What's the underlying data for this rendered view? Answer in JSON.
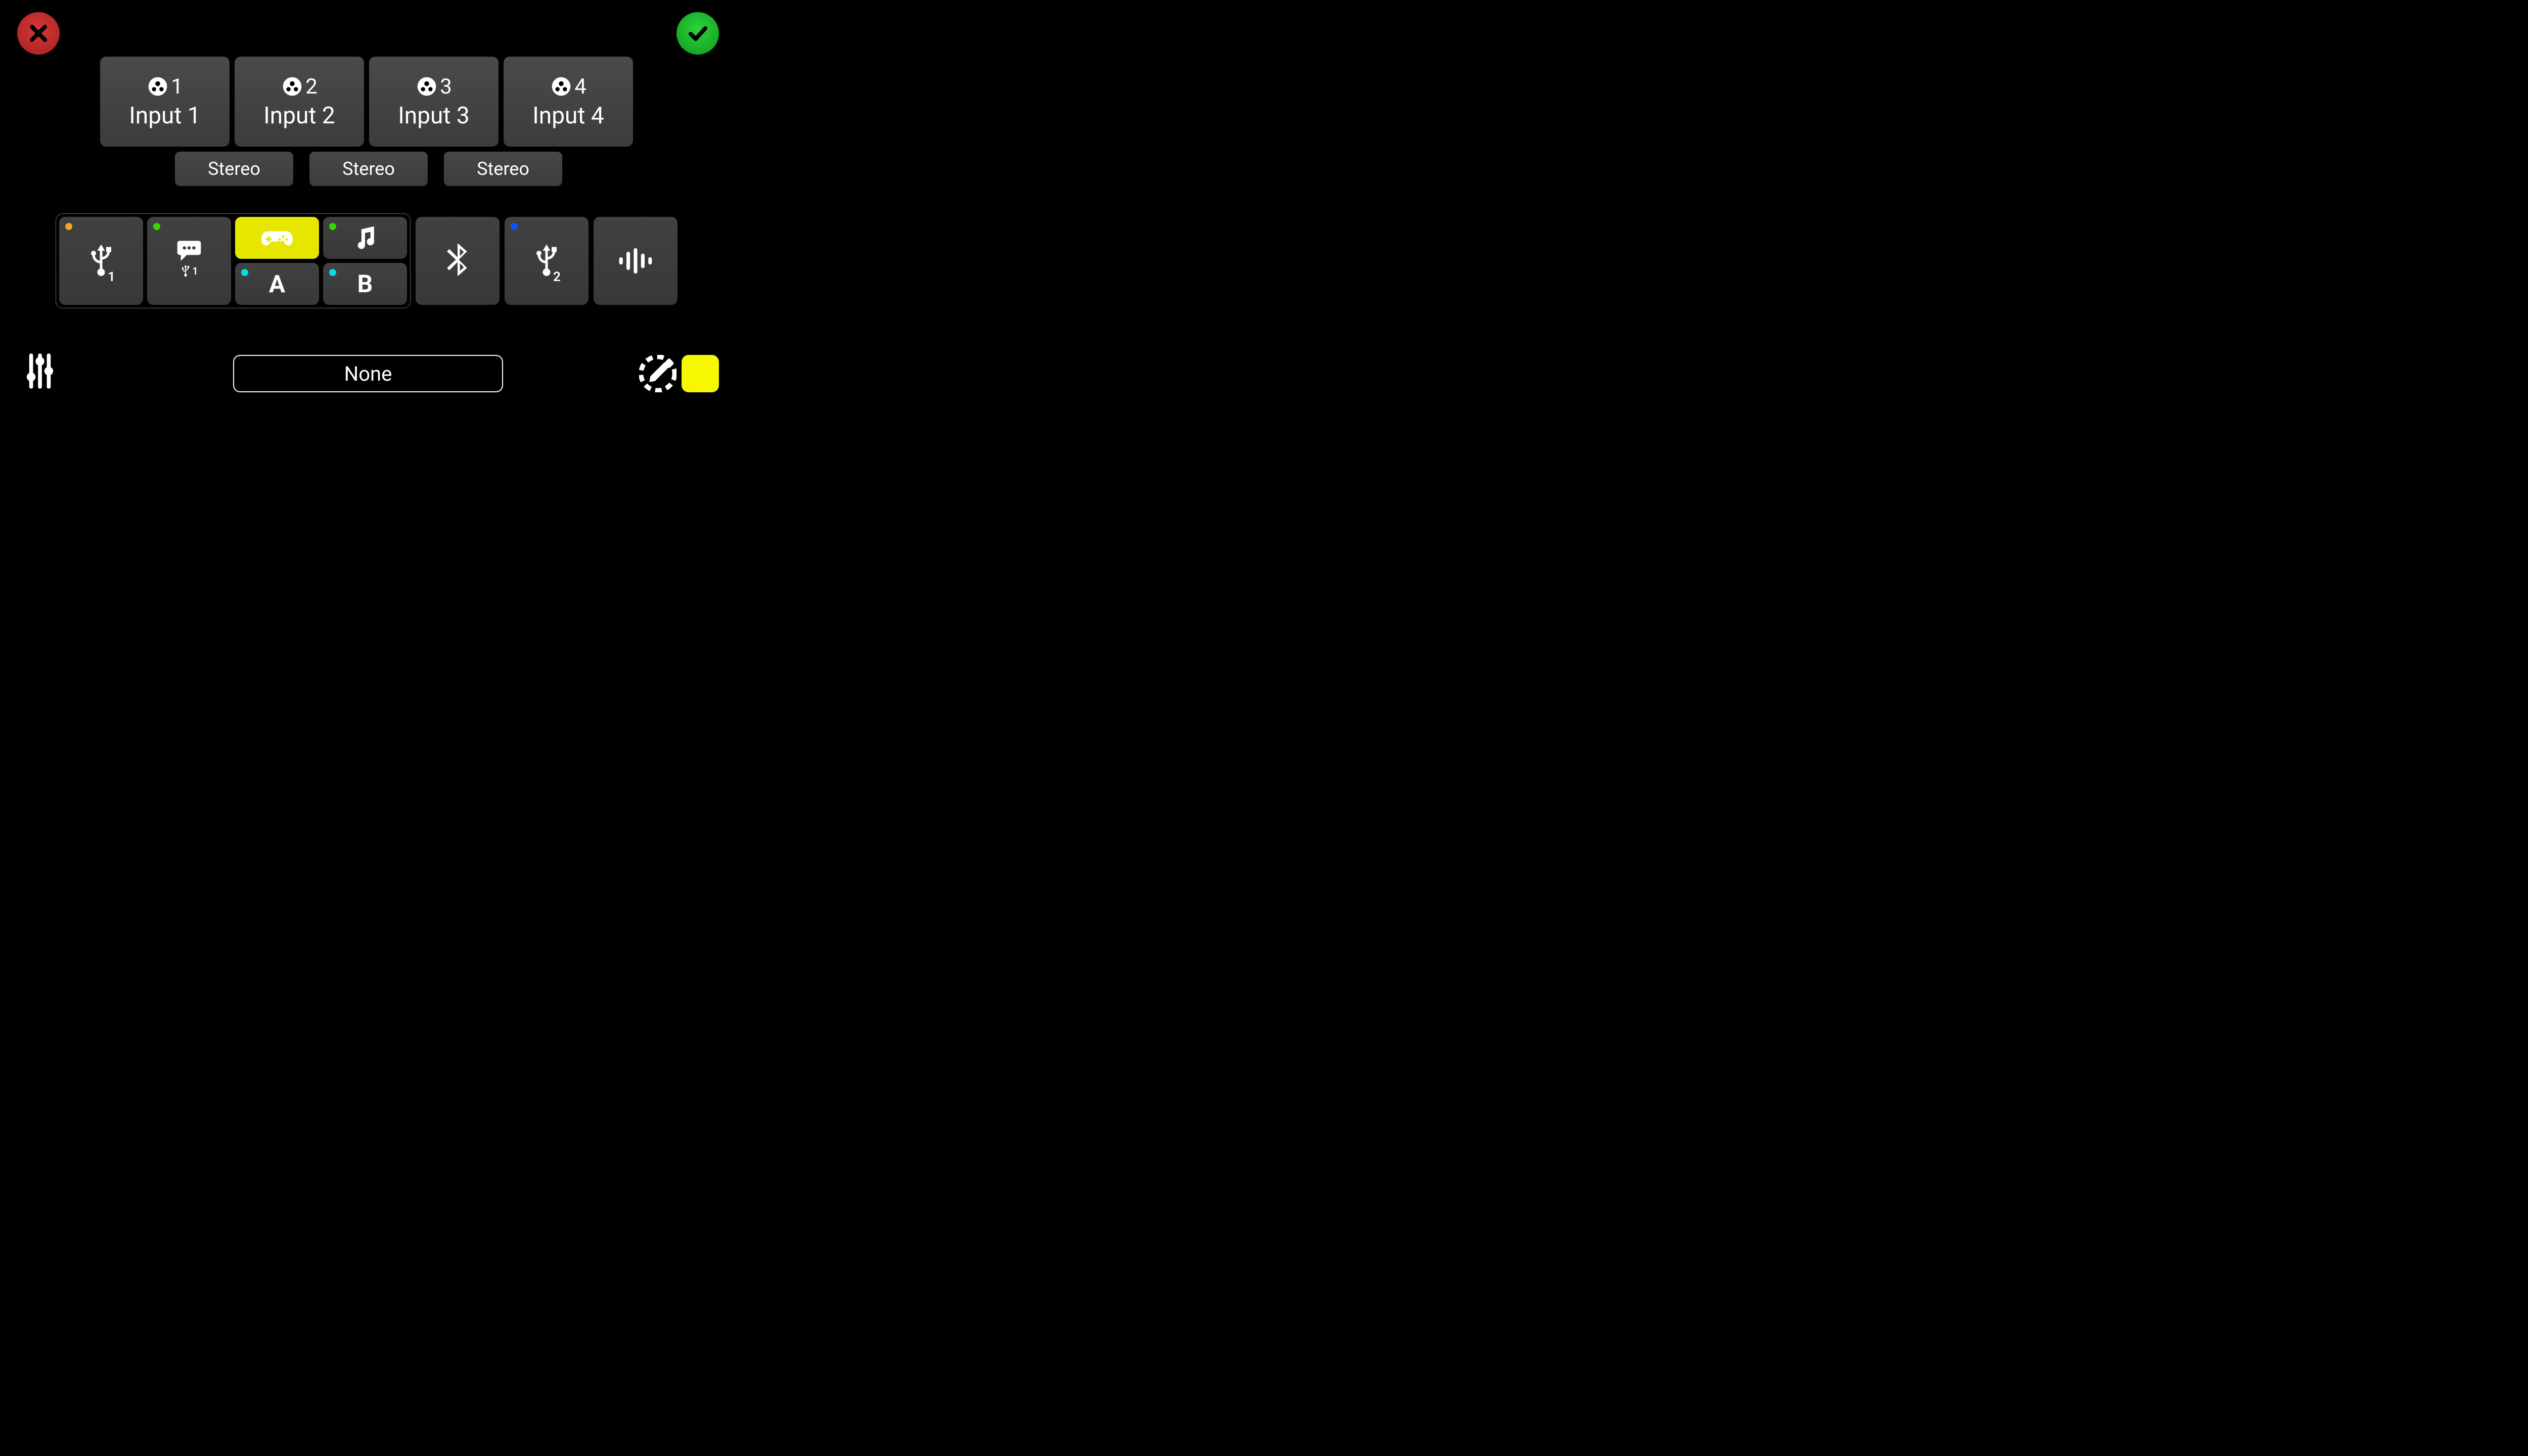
{
  "inputs": [
    {
      "num": "1",
      "label": "Input 1"
    },
    {
      "num": "2",
      "label": "Input 2"
    },
    {
      "num": "3",
      "label": "Input 3"
    },
    {
      "num": "4",
      "label": "Input 4"
    }
  ],
  "stereo_label": "Stereo",
  "sources": {
    "usb1_sub": "1",
    "chat_sub": "1",
    "a_label": "A",
    "b_label": "B",
    "usb2_sub": "2"
  },
  "none_label": "None",
  "colors": {
    "swatch": "#f7f700",
    "selected_bg": "#e6e600"
  },
  "icons": {
    "close": "close-icon",
    "confirm": "check-icon",
    "input_node": "xlr-combo-icon",
    "usb": "usb-icon",
    "chat": "chat-bubble-icon",
    "game": "gamepad-icon",
    "music": "music-note-icon",
    "bluetooth": "bluetooth-icon",
    "soundwave": "soundwave-icon",
    "sliders": "sliders-icon",
    "eyedropper": "eyedropper-icon"
  }
}
